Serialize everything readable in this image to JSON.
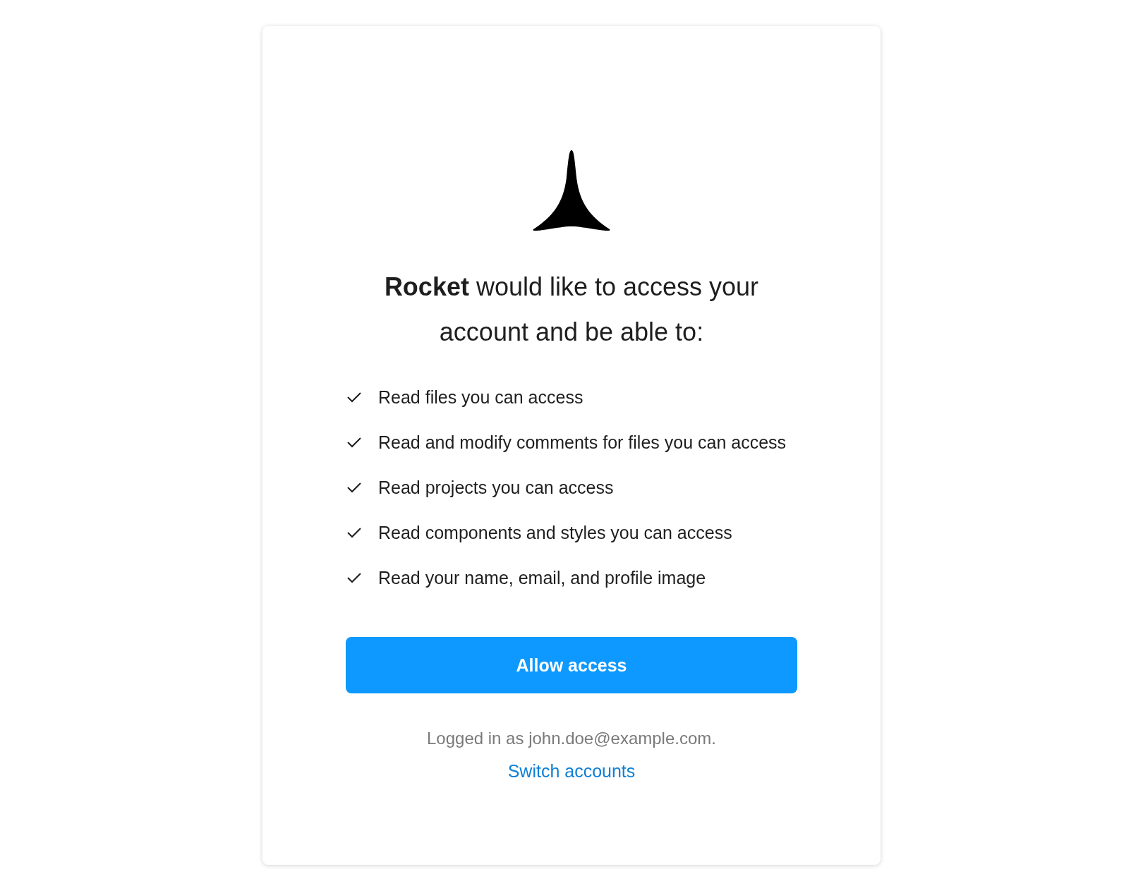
{
  "heading": "**Rocket** would like to access your account and be able to:",
  "permissions": [
    "Read files you can access",
    "Read and modify comments for files you can access",
    "Read projects you can access",
    "Read components and styles you can access",
    "Read your name, email, and profile image"
  ],
  "allow_button": "Allow access",
  "logged_in": "Logged in as john.doe@example.com.",
  "switch_link": "Switch accounts"
}
